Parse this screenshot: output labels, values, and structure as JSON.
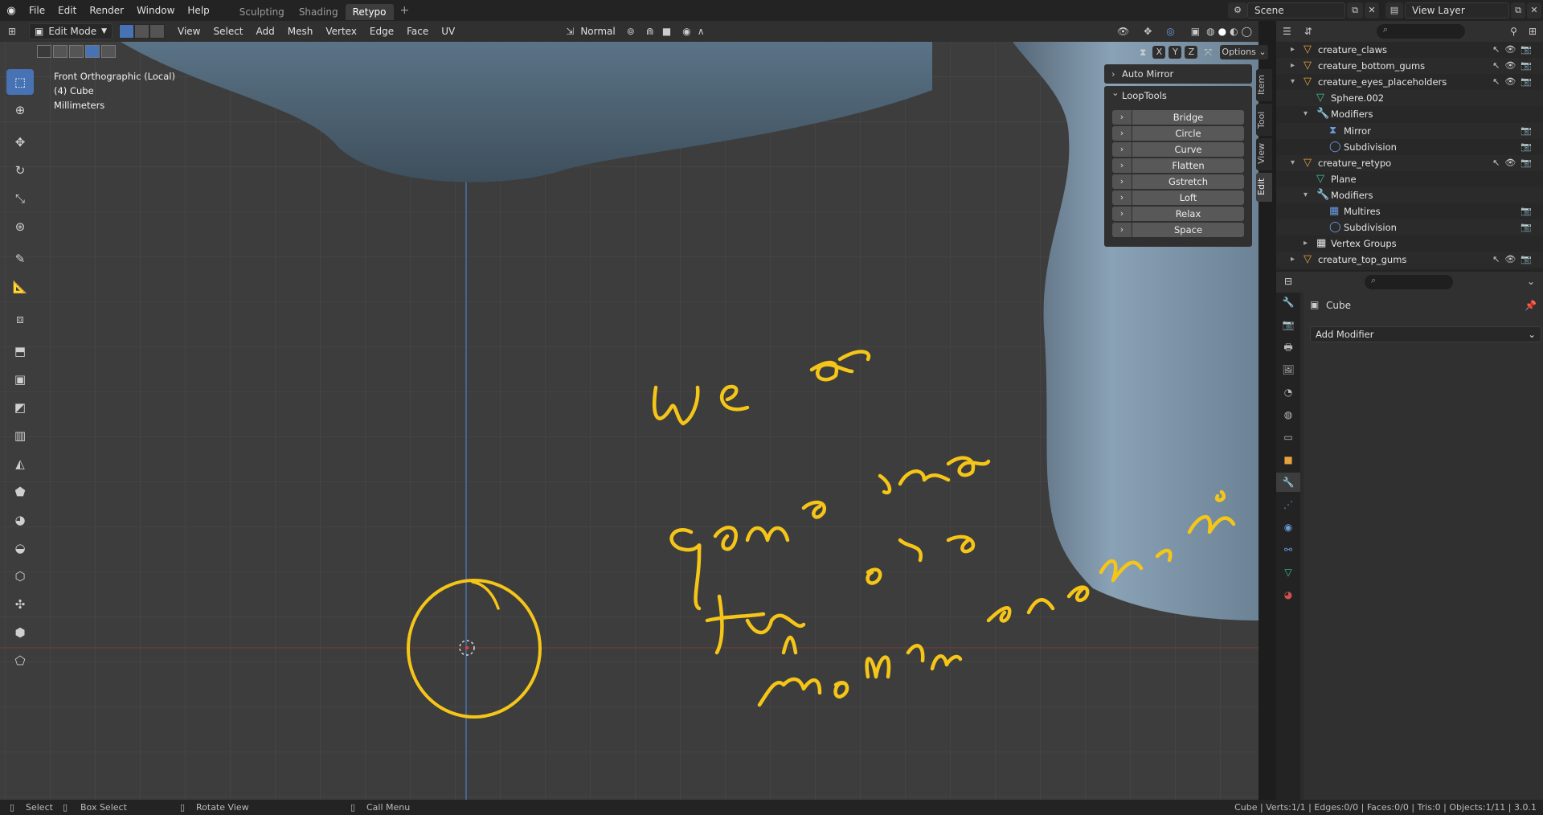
{
  "topbar": {
    "menus": [
      "File",
      "Edit",
      "Render",
      "Window",
      "Help"
    ],
    "workspaces": [
      "Sculpting",
      "Shading",
      "Retypo"
    ],
    "active_workspace": "Retypo",
    "scene": "Scene",
    "view_layer": "View Layer"
  },
  "viewport_header": {
    "mode": "Edit Mode",
    "menus": [
      "View",
      "Select",
      "Add",
      "Mesh",
      "Vertex",
      "Edge",
      "Face",
      "UV"
    ],
    "orientation": "Normal",
    "axes": [
      "X",
      "Y",
      "Z"
    ],
    "options": "Options"
  },
  "viewport": {
    "view_name": "Front Orthographic (Local)",
    "object": "(4) Cube",
    "units": "Millimeters",
    "annotation_text": [
      "We are",
      "gonna use",
      "the skin",
      "modifier workflow"
    ]
  },
  "panels": {
    "auto_mirror": "Auto Mirror",
    "looptools": "LoopTools",
    "looptools_items": [
      "Bridge",
      "Circle",
      "Curve",
      "Flatten",
      "Gstretch",
      "Loft",
      "Relax",
      "Space"
    ]
  },
  "side_tabs": [
    "Item",
    "Tool",
    "View",
    "Edit"
  ],
  "outliner": {
    "rows": [
      {
        "label": "creature_claws",
        "depth": 1
      },
      {
        "label": "creature_bottom_gums",
        "depth": 1
      },
      {
        "label": "creature_eyes_placeholders",
        "depth": 1
      },
      {
        "label": "Sphere.002",
        "depth": 2
      },
      {
        "label": "Modifiers",
        "depth": 2
      },
      {
        "label": "Mirror",
        "depth": 3
      },
      {
        "label": "Subdivision",
        "depth": 3
      },
      {
        "label": "creature_retypo",
        "depth": 1
      },
      {
        "label": "Plane",
        "depth": 2
      },
      {
        "label": "Modifiers",
        "depth": 2
      },
      {
        "label": "Multires",
        "depth": 3
      },
      {
        "label": "Subdivision",
        "depth": 3
      },
      {
        "label": "Vertex Groups",
        "depth": 2
      },
      {
        "label": "creature_top_gums",
        "depth": 1
      }
    ]
  },
  "properties": {
    "object_name": "Cube",
    "add_modifier": "Add Modifier"
  },
  "statusbar": {
    "select": "Select",
    "box_select": "Box Select",
    "rotate_view": "Rotate View",
    "call_menu": "Call Menu",
    "stats": "Cube | Verts:1/1 | Edges:0/0 | Faces:0/0 | Tris:0 | Objects:1/11 | 3.0.1"
  },
  "colors": {
    "accent": "#4772b3",
    "annotation": "#f5c518",
    "mesh_orange": "#e8a13f",
    "model": "#7c95aa"
  }
}
